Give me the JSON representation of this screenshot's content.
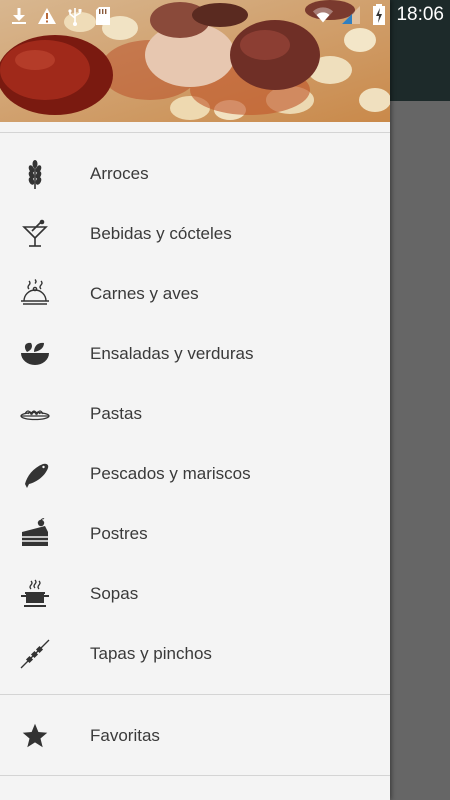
{
  "status_bar": {
    "time": "18:06",
    "left_icons": [
      "download-icon",
      "warning-icon",
      "usb-icon",
      "sd-card-icon"
    ],
    "right_icons": [
      "wifi-icon",
      "signal-icon",
      "battery-charging-icon"
    ]
  },
  "drawer": {
    "header_image": "food-photo",
    "items": [
      {
        "label": "Arroces",
        "icon": "wheat-icon"
      },
      {
        "label": "Bebidas y cócteles",
        "icon": "cocktail-icon"
      },
      {
        "label": "Carnes y aves",
        "icon": "cloche-icon"
      },
      {
        "label": "Ensaladas y verduras",
        "icon": "salad-bowl-icon"
      },
      {
        "label": "Pastas",
        "icon": "pasta-plate-icon"
      },
      {
        "label": "Pescados y mariscos",
        "icon": "fish-icon"
      },
      {
        "label": "Postres",
        "icon": "cake-icon"
      },
      {
        "label": "Sopas",
        "icon": "soup-pot-icon"
      },
      {
        "label": "Tapas y pinchos",
        "icon": "skewer-icon"
      }
    ],
    "favorites": {
      "label": "Favoritas",
      "icon": "star-icon"
    }
  },
  "colors": {
    "drawer_bg": "#f4f4f4",
    "text": "#3a3a3a",
    "icon": "#333333",
    "scrim": "#666666",
    "toolbar": "#1d2a2a"
  }
}
